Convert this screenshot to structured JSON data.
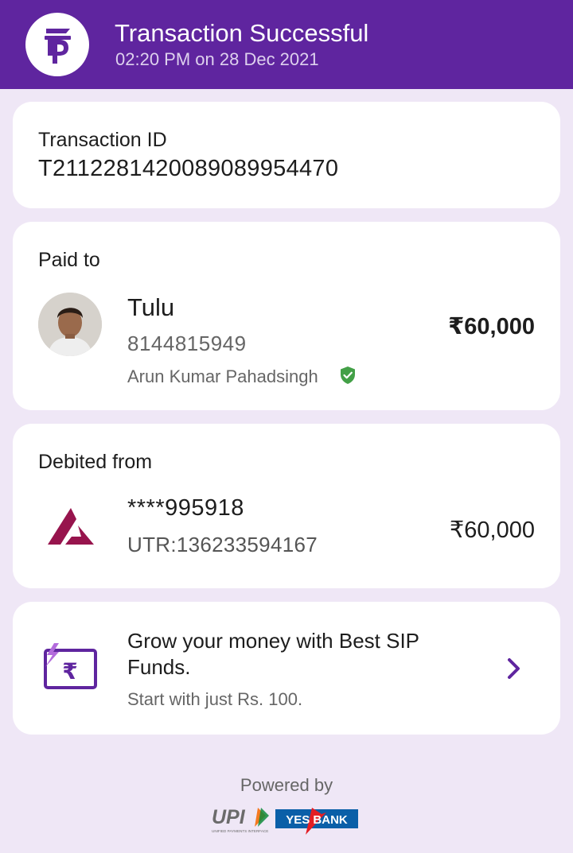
{
  "header": {
    "title": "Transaction Successful",
    "subtitle": "02:20 PM on 28 Dec 2021",
    "logo_icon": "phonepe-logo-icon",
    "brand_color": "#5f259f"
  },
  "transaction": {
    "label": "Transaction ID",
    "id": "T2112281420089089954470"
  },
  "paid_to": {
    "label": "Paid to",
    "name": "Tulu",
    "phone": "8144815949",
    "full_name": "Arun Kumar Pahadsingh",
    "amount": "₹60,000",
    "verified_icon": "verified-shield-icon",
    "verified_color": "#43a047"
  },
  "debited_from": {
    "label": "Debited from",
    "account": "****995918",
    "utr": "UTR:136233594167",
    "amount": "₹60,000",
    "bank_icon": "axis-bank-logo-icon",
    "bank_color": "#97144d"
  },
  "promo": {
    "title": "Grow your money with Best SIP Funds.",
    "subtitle": "Start with just Rs. 100.",
    "icon": "rupee-card-icon"
  },
  "footer": {
    "powered_by": "Powered by",
    "upi_label": "UPI",
    "upi_caption": "UNIFIED PAYMENTS INTERFACE",
    "bank_label": "YES BANK"
  }
}
